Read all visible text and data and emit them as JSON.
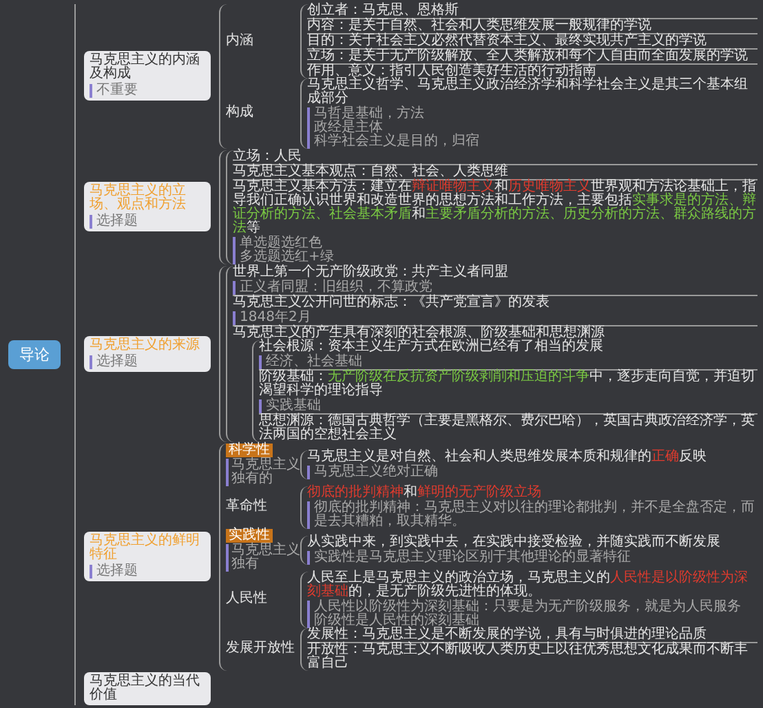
{
  "root": {
    "title": "导论"
  },
  "branches": [
    {
      "title": "马克思主义的内涵及构成",
      "note": "不重要",
      "highlighted": false,
      "groups": [
        {
          "label": {
            "text": "内涵",
            "kind": "plain"
          },
          "items": [
            {
              "text": "创立者：马克思、恩格斯"
            },
            {
              "text": "内容：是关于自然、社会和人类思维发展一般规律的学说"
            },
            {
              "text": "目的：关于社会主义必然代替资本主义、最终实现共产主义的学说"
            },
            {
              "text": "立场：是关于无产阶级解放、全人类解放和每个人自由而全面发展的学说"
            },
            {
              "text": "作用、意义：指引人民创造美好生活的行动指南"
            }
          ]
        },
        {
          "label": {
            "text": "构成",
            "kind": "plain"
          },
          "items": [
            {
              "text": "马克思主义哲学、马克思主义政治经济学和科学社会主义是其三个基本组成部分",
              "notes": [
                "马哲是基础，方法",
                "政经是主体",
                "科学社会主义是目的，归宿"
              ]
            }
          ]
        }
      ]
    },
    {
      "title": "马克思主义的立场、观点和方法",
      "note": "选择题",
      "highlighted": true,
      "groups": [
        {
          "items": [
            {
              "text": "立场：人民"
            },
            {
              "text": "马克思主义基本观点：自然、社会、人类思维"
            },
            {
              "text": [
                {
                  "t": "马克思主义基本方法：建立在",
                  "kind": "plain"
                },
                {
                  "t": "辩证唯物主义",
                  "kind": "red"
                },
                {
                  "t": "和",
                  "kind": "plain"
                },
                {
                  "t": "历史唯物主义",
                  "kind": "red"
                },
                {
                  "t": "世界观和方法论基础上，指导我们正确认识世界和改造世界的思想方法和工作方法，主要包括",
                  "kind": "plain"
                },
                {
                  "t": "实事求是的方法、辩证分析的方法、社会基本矛盾",
                  "kind": "green"
                },
                {
                  "t": "和",
                  "kind": "plain"
                },
                {
                  "t": "主要矛盾分析的方法、历史分析的方法、群众路线的方法",
                  "kind": "green"
                },
                {
                  "t": "等",
                  "kind": "plain"
                }
              ],
              "notes": [
                "单选题选红色",
                "多选题选红+绿"
              ]
            }
          ]
        }
      ]
    },
    {
      "title": "马克思主义的来源",
      "note": "选择题",
      "highlighted": true,
      "groups": [
        {
          "items": [
            {
              "text": "世界上第一个无产阶级政党：共产主义者同盟",
              "notes": [
                "正义者同盟：旧组织，不算政党"
              ]
            },
            {
              "text": "马克思主义公开问世的标志：《共产党宣言》的发表",
              "notes": [
                "1848年2月"
              ]
            },
            {
              "text": "马克思主义的产生具有深刻的社会根源、阶级基础和思想渊源",
              "children": [
                {
                  "text": "社会根源：资本主义生产方式在欧洲已经有了相当的发展",
                  "notes": [
                    "经济、社会基础"
                  ]
                },
                {
                  "text": [
                    {
                      "t": "阶级基础：",
                      "kind": "plain"
                    },
                    {
                      "t": "无产阶级在反抗资产阶级剥削和压迫的斗争",
                      "kind": "green"
                    },
                    {
                      "t": "中，逐步走向自觉，并迫切渴望科学的理论指导",
                      "kind": "plain"
                    }
                  ],
                  "notes": [
                    "实践基础"
                  ]
                },
                {
                  "text": "思想渊源：德国古典哲学（主要是黑格尔、费尔巴哈），英国古典政治经济学，英法两国的空想社会主义"
                }
              ]
            }
          ]
        }
      ]
    },
    {
      "title": "马克思主义的鲜明特征",
      "note": "选择题",
      "highlighted": true,
      "groups": [
        {
          "label": {
            "text": "科学性",
            "kind": "tag"
          },
          "label_note": "马克思主义独有的",
          "items": [
            {
              "text": [
                {
                  "t": "马克思主义是对自然、社会和人类思维发展本质和规律的",
                  "kind": "plain"
                },
                {
                  "t": "正确",
                  "kind": "red"
                },
                {
                  "t": "反映",
                  "kind": "plain"
                }
              ],
              "notes": [
                "马克思主义绝对正确"
              ]
            }
          ]
        },
        {
          "label": {
            "text": "革命性",
            "kind": "plain"
          },
          "items": [
            {
              "text": [
                {
                  "t": "彻底的批判精神",
                  "kind": "red"
                },
                {
                  "t": "和",
                  "kind": "plain"
                },
                {
                  "t": "鲜明的无产阶级立场",
                  "kind": "red"
                }
              ],
              "notes": [
                "彻底的批判精神：马克思主义对以往的理论都批判，并不是全盘否定，而是去其糟粕，取其精华。"
              ]
            }
          ]
        },
        {
          "label": {
            "text": "实践性",
            "kind": "tag"
          },
          "label_note": "马克思主义独有",
          "items": [
            {
              "text": "从实践中来，到实践中去，在实践中接受检验，并随实践而不断发展",
              "notes": [
                "实践性是马克思主义理论区别于其他理论的显著特征"
              ]
            }
          ]
        },
        {
          "label": {
            "text": "人民性",
            "kind": "plain"
          },
          "items": [
            {
              "text": [
                {
                  "t": "人民至上是马克思主义的政治立场，马克思主义的",
                  "kind": "plain"
                },
                {
                  "t": "人民性是以阶级性为深刻基础",
                  "kind": "red"
                },
                {
                  "t": "的，是无产阶级先进性的体现。",
                  "kind": "plain"
                }
              ],
              "notes": [
                "人民性以阶级性为深刻基础：只要是为无产阶级服务，就是为人民服务",
                "阶级性是人民性的深刻基础"
              ]
            }
          ]
        },
        {
          "label": {
            "text": "发展开放性",
            "kind": "plain"
          },
          "items": [
            {
              "text": "发展性：马克思主义是不断发展的学说，具有与时俱进的理论品质"
            },
            {
              "text": "开放性：马克思主义不断吸收人类历史上以往优秀思想文化成果而不断丰富自己"
            }
          ]
        }
      ]
    },
    {
      "title": "马克思主义的当代价值",
      "highlighted": false
    }
  ]
}
